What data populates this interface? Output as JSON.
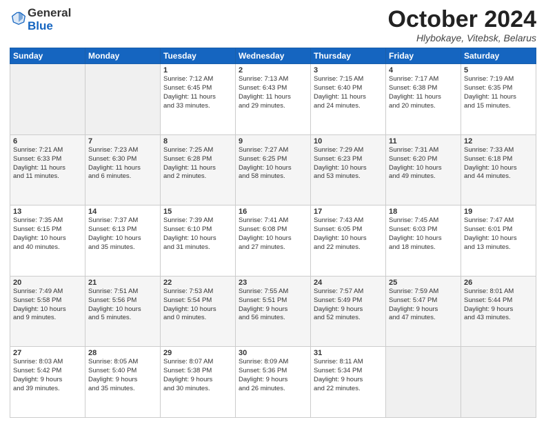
{
  "logo": {
    "general": "General",
    "blue": "Blue"
  },
  "header": {
    "month": "October 2024",
    "location": "Hlybokaye, Vitebsk, Belarus"
  },
  "days_of_week": [
    "Sunday",
    "Monday",
    "Tuesday",
    "Wednesday",
    "Thursday",
    "Friday",
    "Saturday"
  ],
  "weeks": [
    [
      {
        "day": "",
        "info": ""
      },
      {
        "day": "",
        "info": ""
      },
      {
        "day": "1",
        "info": "Sunrise: 7:12 AM\nSunset: 6:45 PM\nDaylight: 11 hours\nand 33 minutes."
      },
      {
        "day": "2",
        "info": "Sunrise: 7:13 AM\nSunset: 6:43 PM\nDaylight: 11 hours\nand 29 minutes."
      },
      {
        "day": "3",
        "info": "Sunrise: 7:15 AM\nSunset: 6:40 PM\nDaylight: 11 hours\nand 24 minutes."
      },
      {
        "day": "4",
        "info": "Sunrise: 7:17 AM\nSunset: 6:38 PM\nDaylight: 11 hours\nand 20 minutes."
      },
      {
        "day": "5",
        "info": "Sunrise: 7:19 AM\nSunset: 6:35 PM\nDaylight: 11 hours\nand 15 minutes."
      }
    ],
    [
      {
        "day": "6",
        "info": "Sunrise: 7:21 AM\nSunset: 6:33 PM\nDaylight: 11 hours\nand 11 minutes."
      },
      {
        "day": "7",
        "info": "Sunrise: 7:23 AM\nSunset: 6:30 PM\nDaylight: 11 hours\nand 6 minutes."
      },
      {
        "day": "8",
        "info": "Sunrise: 7:25 AM\nSunset: 6:28 PM\nDaylight: 11 hours\nand 2 minutes."
      },
      {
        "day": "9",
        "info": "Sunrise: 7:27 AM\nSunset: 6:25 PM\nDaylight: 10 hours\nand 58 minutes."
      },
      {
        "day": "10",
        "info": "Sunrise: 7:29 AM\nSunset: 6:23 PM\nDaylight: 10 hours\nand 53 minutes."
      },
      {
        "day": "11",
        "info": "Sunrise: 7:31 AM\nSunset: 6:20 PM\nDaylight: 10 hours\nand 49 minutes."
      },
      {
        "day": "12",
        "info": "Sunrise: 7:33 AM\nSunset: 6:18 PM\nDaylight: 10 hours\nand 44 minutes."
      }
    ],
    [
      {
        "day": "13",
        "info": "Sunrise: 7:35 AM\nSunset: 6:15 PM\nDaylight: 10 hours\nand 40 minutes."
      },
      {
        "day": "14",
        "info": "Sunrise: 7:37 AM\nSunset: 6:13 PM\nDaylight: 10 hours\nand 35 minutes."
      },
      {
        "day": "15",
        "info": "Sunrise: 7:39 AM\nSunset: 6:10 PM\nDaylight: 10 hours\nand 31 minutes."
      },
      {
        "day": "16",
        "info": "Sunrise: 7:41 AM\nSunset: 6:08 PM\nDaylight: 10 hours\nand 27 minutes."
      },
      {
        "day": "17",
        "info": "Sunrise: 7:43 AM\nSunset: 6:05 PM\nDaylight: 10 hours\nand 22 minutes."
      },
      {
        "day": "18",
        "info": "Sunrise: 7:45 AM\nSunset: 6:03 PM\nDaylight: 10 hours\nand 18 minutes."
      },
      {
        "day": "19",
        "info": "Sunrise: 7:47 AM\nSunset: 6:01 PM\nDaylight: 10 hours\nand 13 minutes."
      }
    ],
    [
      {
        "day": "20",
        "info": "Sunrise: 7:49 AM\nSunset: 5:58 PM\nDaylight: 10 hours\nand 9 minutes."
      },
      {
        "day": "21",
        "info": "Sunrise: 7:51 AM\nSunset: 5:56 PM\nDaylight: 10 hours\nand 5 minutes."
      },
      {
        "day": "22",
        "info": "Sunrise: 7:53 AM\nSunset: 5:54 PM\nDaylight: 10 hours\nand 0 minutes."
      },
      {
        "day": "23",
        "info": "Sunrise: 7:55 AM\nSunset: 5:51 PM\nDaylight: 9 hours\nand 56 minutes."
      },
      {
        "day": "24",
        "info": "Sunrise: 7:57 AM\nSunset: 5:49 PM\nDaylight: 9 hours\nand 52 minutes."
      },
      {
        "day": "25",
        "info": "Sunrise: 7:59 AM\nSunset: 5:47 PM\nDaylight: 9 hours\nand 47 minutes."
      },
      {
        "day": "26",
        "info": "Sunrise: 8:01 AM\nSunset: 5:44 PM\nDaylight: 9 hours\nand 43 minutes."
      }
    ],
    [
      {
        "day": "27",
        "info": "Sunrise: 8:03 AM\nSunset: 5:42 PM\nDaylight: 9 hours\nand 39 minutes."
      },
      {
        "day": "28",
        "info": "Sunrise: 8:05 AM\nSunset: 5:40 PM\nDaylight: 9 hours\nand 35 minutes."
      },
      {
        "day": "29",
        "info": "Sunrise: 8:07 AM\nSunset: 5:38 PM\nDaylight: 9 hours\nand 30 minutes."
      },
      {
        "day": "30",
        "info": "Sunrise: 8:09 AM\nSunset: 5:36 PM\nDaylight: 9 hours\nand 26 minutes."
      },
      {
        "day": "31",
        "info": "Sunrise: 8:11 AM\nSunset: 5:34 PM\nDaylight: 9 hours\nand 22 minutes."
      },
      {
        "day": "",
        "info": ""
      },
      {
        "day": "",
        "info": ""
      }
    ]
  ]
}
